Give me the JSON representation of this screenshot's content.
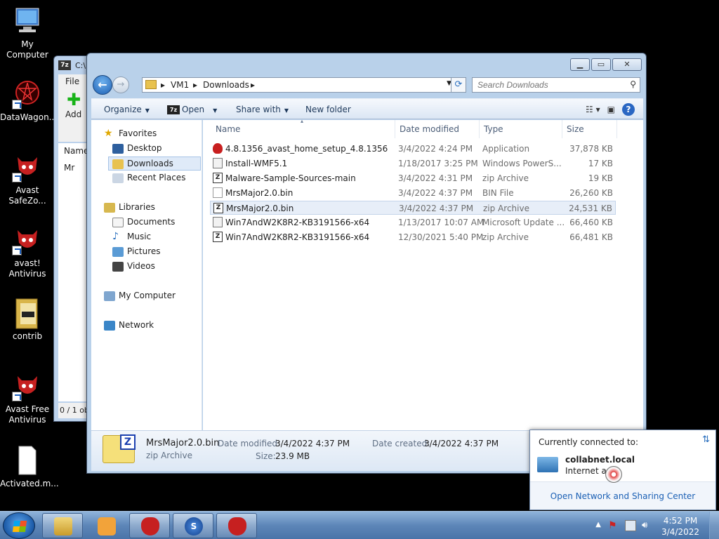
{
  "desktop": {
    "icons": [
      {
        "label": "My Computer"
      },
      {
        "label": "DataWagon..."
      },
      {
        "label": "Avast SafeZo..."
      },
      {
        "label": "avast! Antivirus"
      },
      {
        "label": "contrib"
      },
      {
        "label": "Avast Free Antivirus"
      },
      {
        "label": "Activated.m..."
      }
    ]
  },
  "bg_window": {
    "title": "C:\\",
    "menu_file": "File",
    "add_label": "Add",
    "list_header": "Name",
    "list_row": "Mr",
    "status": "0 / 1 ob"
  },
  "explorer": {
    "breadcrumb": [
      "VM1",
      "Downloads"
    ],
    "search_placeholder": "Search Downloads",
    "toolbar": {
      "organize": "Organize",
      "open": "Open",
      "share_with": "Share with",
      "new_folder": "New folder"
    },
    "nav": {
      "favorites": "Favorites",
      "desktop": "Desktop",
      "downloads": "Downloads",
      "recent_places": "Recent Places",
      "libraries": "Libraries",
      "documents": "Documents",
      "music": "Music",
      "pictures": "Pictures",
      "videos": "Videos",
      "my_computer": "My Computer",
      "network": "Network"
    },
    "columns": {
      "name": "Name",
      "date": "Date modified",
      "type": "Type",
      "size": "Size"
    },
    "files": [
      {
        "name": "4.8.1356_avast_home_setup_4.8.1356",
        "date": "3/4/2022 4:24 PM",
        "type": "Application",
        "size": "37,878 KB",
        "icon": "avast-icon"
      },
      {
        "name": "Install-WMF5.1",
        "date": "1/18/2017 3:25 PM",
        "type": "Windows PowerS...",
        "size": "17 KB",
        "icon": "powershell-icon"
      },
      {
        "name": "Malware-Sample-Sources-main",
        "date": "3/4/2022 4:31 PM",
        "type": "zip Archive",
        "size": "19 KB",
        "icon": "zip-icon"
      },
      {
        "name": "MrsMajor2.0.bin",
        "date": "3/4/2022 4:37 PM",
        "type": "BIN File",
        "size": "26,260 KB",
        "icon": "file-icon"
      },
      {
        "name": "MrsMajor2.0.bin",
        "date": "3/4/2022 4:37 PM",
        "type": "zip Archive",
        "size": "24,531 KB",
        "icon": "zip-icon"
      },
      {
        "name": "Win7AndW2K8R2-KB3191566-x64",
        "date": "1/13/2017 10:07 AM",
        "type": "Microsoft Update ...",
        "size": "66,460 KB",
        "icon": "msu-icon"
      },
      {
        "name": "Win7AndW2K8R2-KB3191566-x64",
        "date": "12/30/2021 5:40 PM",
        "type": "zip Archive",
        "size": "66,481 KB",
        "icon": "zip-icon"
      }
    ],
    "details": {
      "name": "MrsMajor2.0.bin",
      "kind": "zip Archive",
      "date_modified_label": "Date modified:",
      "date_modified": "3/4/2022 4:37 PM",
      "date_created_label": "Date created:",
      "date_created": "3/4/2022 4:37 PM",
      "size_label": "Size:",
      "size": "23.9 MB"
    }
  },
  "network_popup": {
    "heading": "Currently connected to:",
    "network_name": "collabnet.local",
    "access": "Internet a",
    "footer_link": "Open Network and Sharing Center"
  },
  "taskbar": {
    "time": "4:52 PM",
    "date": "3/4/2022"
  },
  "colors": {
    "accent": "#1a5fb4",
    "selection": "#dfeaf8"
  }
}
